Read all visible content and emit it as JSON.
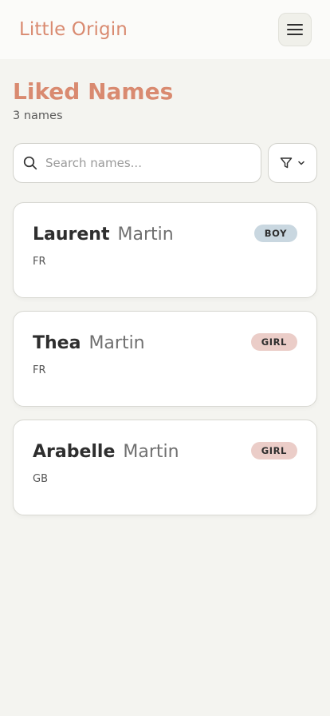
{
  "header": {
    "brand": "Little Origin",
    "menu_icon": "hamburger-icon"
  },
  "page": {
    "title": "Liked Names",
    "count": "3 names"
  },
  "search": {
    "placeholder": "Search names...",
    "value": "",
    "icon": "search-icon"
  },
  "filter": {
    "icon": "filter-icon",
    "chevron_icon": "chevron-down-icon"
  },
  "colors": {
    "brand": "#d98a70",
    "boy_badge": "#c9d7e0",
    "girl_badge": "#ebcdc8"
  },
  "cards": [
    {
      "first": "Laurent",
      "last": "Martin",
      "origin": "FR",
      "gender": "BOY"
    },
    {
      "first": "Thea",
      "last": "Martin",
      "origin": "FR",
      "gender": "GIRL"
    },
    {
      "first": "Arabelle",
      "last": "Martin",
      "origin": "GB",
      "gender": "GIRL"
    }
  ]
}
